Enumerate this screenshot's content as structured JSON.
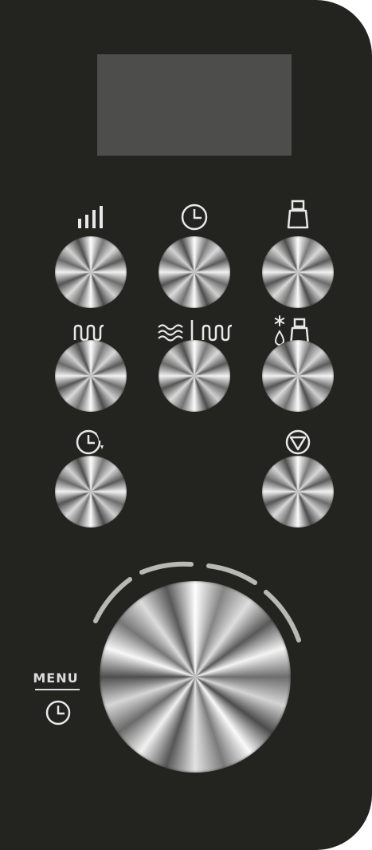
{
  "panel": {
    "background": "#232320",
    "display_color": "#4d4d4c",
    "icon_color": "#e8e8e8",
    "arc_color": "#b8b8b4"
  },
  "buttons": [
    {
      "name": "power-level-button",
      "icon": "signal-bars-icon"
    },
    {
      "name": "clock-button",
      "icon": "clock-icon"
    },
    {
      "name": "weight-program-button",
      "icon": "weight-icon"
    },
    {
      "name": "grill-button",
      "icon": "grill-icon"
    },
    {
      "name": "combi-microwave-grill-button",
      "icon": "microwave-grill-icon"
    },
    {
      "name": "defrost-by-weight-button",
      "icon": "defrost-weight-icon"
    },
    {
      "name": "timer-start-button",
      "icon": "timer-start-icon"
    },
    {
      "name": "stop-button",
      "icon": "stop-icon"
    }
  ],
  "knob": {
    "name": "main-dial",
    "menu_label": "MENU",
    "menu_icon": "clock-icon"
  }
}
